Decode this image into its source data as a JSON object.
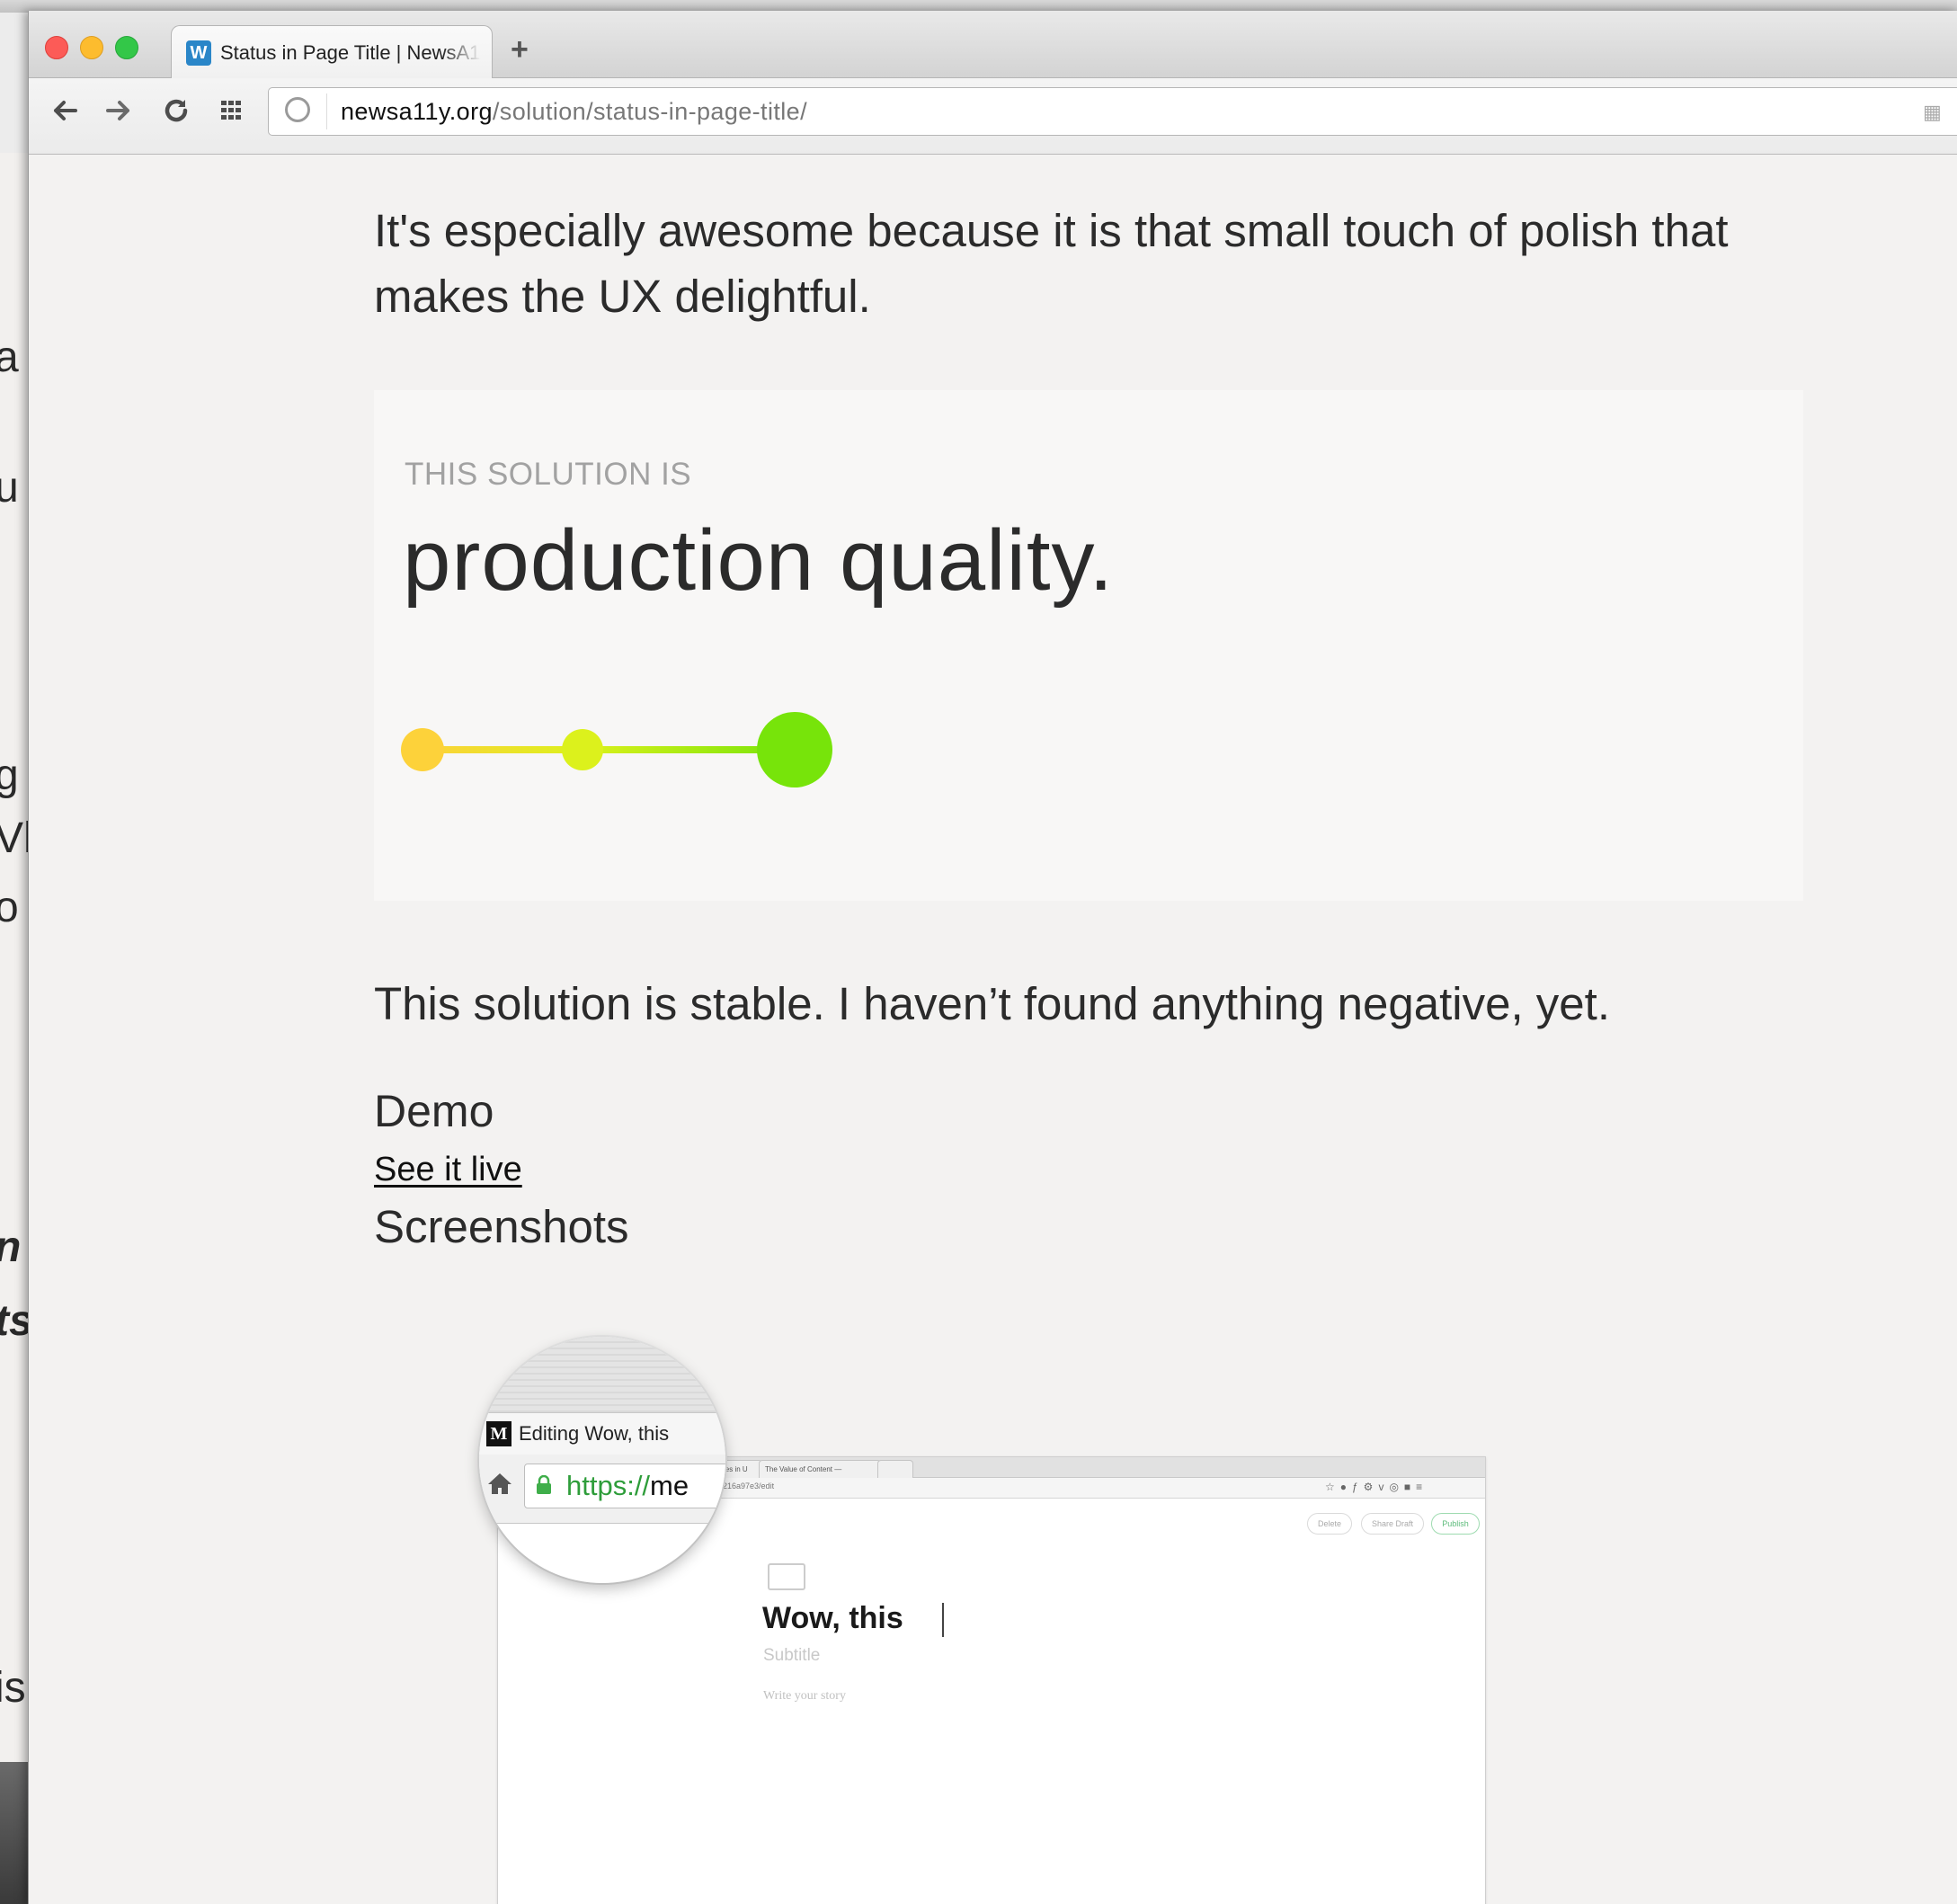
{
  "browser": {
    "tab_title": "Status in Page Title | NewsA11y",
    "tab_favicon": "W",
    "new_tab_label": "+",
    "url_host": "newsa11y.org",
    "url_path": "/solution/status-in-page-title/",
    "icons": {
      "back": "arrow-left-icon",
      "forward": "arrow-right-icon",
      "reload": "reload-icon",
      "apps": "apps-grid-icon",
      "site_info": "globe-icon"
    }
  },
  "background_window": {
    "fragments": [
      "a",
      "u",
      "g",
      "Vh",
      "o",
      "n",
      "ts",
      "is"
    ]
  },
  "article": {
    "intro": "It's especially awesome because it is that small touch of polish that makes the UX delightful.",
    "status_card": {
      "eyebrow": "THIS SOLUTION IS",
      "value": "production quality.",
      "meter": {
        "stages": 3,
        "current_stage": 3,
        "colors": [
          "#fdd23a",
          "#dcf11c",
          "#77e40a"
        ]
      }
    },
    "stable_note": "This solution is stable. I haven’t found anything negative, yet.",
    "demo_heading": "Demo",
    "demo_link": "See it live",
    "screenshots_heading": "Screenshots"
  },
  "screenshot": {
    "tabs": [
      "ation Principles in U",
      "The Value of Content —",
      ""
    ],
    "url_fragment": "07216a97e3/edit",
    "buttons": {
      "delete": "Delete",
      "share": "Share Draft",
      "publish": "Publish"
    },
    "story_title": "Wow, this",
    "subtitle_placeholder": "Subtitle",
    "body_placeholder": "Write your story",
    "magnifier": {
      "tab_icon": "M",
      "tab_title": "Editing Wow, this",
      "url_scheme": "https://",
      "url_rest": "me"
    }
  },
  "colors": {
    "page_bg": "#f3f2f1",
    "card_bg": "#f8f7f6",
    "text": "#2b2b2b",
    "eyebrow": "#a2a2a2"
  }
}
